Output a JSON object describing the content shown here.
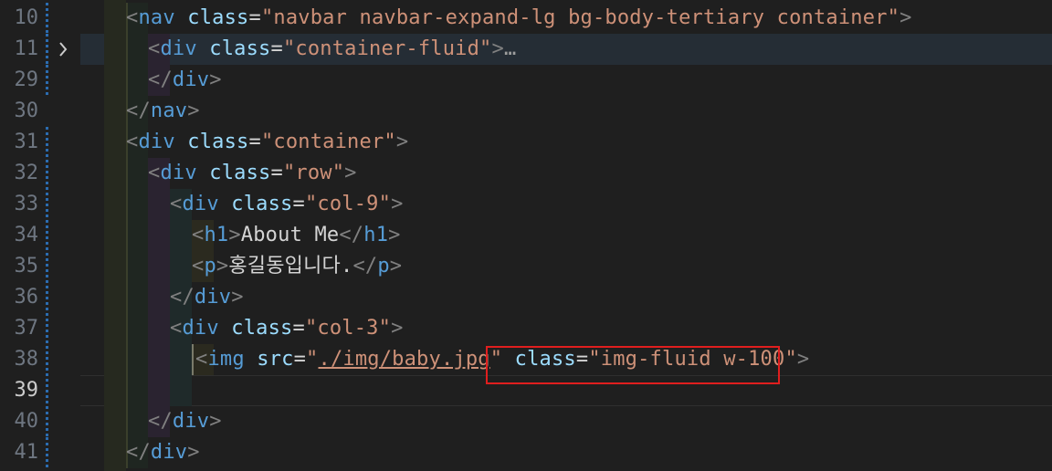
{
  "editor": {
    "line_numbers": [
      "10",
      "11",
      "29",
      "30",
      "31",
      "32",
      "33",
      "34",
      "35",
      "36",
      "37",
      "38",
      "39",
      "40",
      "41"
    ],
    "active_line": "39",
    "fold_icon": "chevron-right-icon",
    "collapsed_ellipsis": "…",
    "highlight_color": "#e01e1e"
  },
  "code": {
    "l10": {
      "tag": "nav",
      "attr": "class",
      "value": "\"navbar navbar-expand-lg bg-body-tertiary container\""
    },
    "l11": {
      "tag": "div",
      "attr": "class",
      "value": "\"container-fluid\""
    },
    "l29": {
      "close": "div"
    },
    "l30": {
      "close": "nav"
    },
    "l31": {
      "tag": "div",
      "attr": "class",
      "value": "\"container\""
    },
    "l32": {
      "tag": "div",
      "attr": "class",
      "value": "\"row\""
    },
    "l33": {
      "tag": "div",
      "attr": "class",
      "value": "\"col-9\""
    },
    "l34": {
      "tag": "h1",
      "text": "About Me",
      "close": "h1"
    },
    "l35": {
      "tag": "p",
      "text": "홍길동입니다.",
      "close": "p"
    },
    "l36": {
      "close": "div"
    },
    "l37": {
      "tag": "div",
      "attr": "class",
      "value": "\"col-3\""
    },
    "l38": {
      "tag": "img",
      "attr1": "src",
      "q1": "\"",
      "link": "./img/baby.jpg",
      "q2": "\"",
      "attr2": "class",
      "value2": "\"img-fluid w-100\""
    },
    "l40": {
      "close": "div"
    },
    "l41": {
      "close": "div"
    }
  }
}
